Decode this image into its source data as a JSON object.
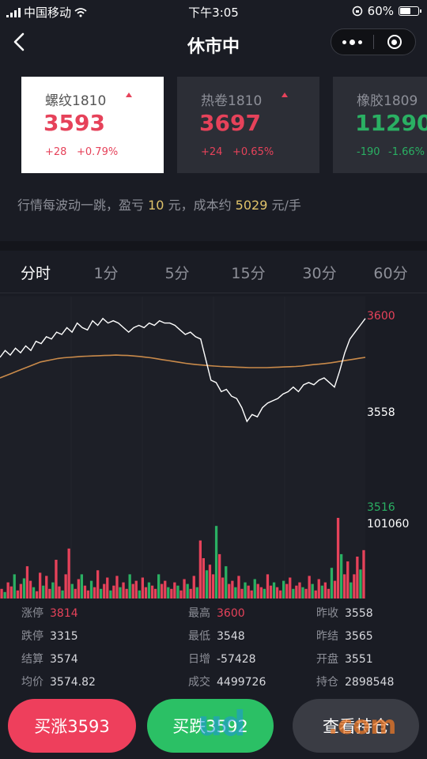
{
  "status": {
    "carrier": "中国移动",
    "time": "下午3:05",
    "battery": "60%",
    "battery_level": 0.6
  },
  "nav": {
    "title": "休市中"
  },
  "cards": [
    {
      "name": "螺纹1810",
      "price": "3593",
      "change": "+28",
      "pct": "+0.79%",
      "direction": "up"
    },
    {
      "name": "热卷1810",
      "price": "3697",
      "change": "+24",
      "pct": "+0.65%",
      "direction": "up"
    },
    {
      "name": "橡胶1809",
      "price": "11290",
      "change": "-190",
      "pct": "-1.66%",
      "direction": "down"
    }
  ],
  "hint": {
    "prefix": "行情每波动一跳，盈亏",
    "tick_value": "10",
    "mid": "元，成本约",
    "cost": "5029",
    "suffix": "元/手"
  },
  "tabs": [
    "分时",
    "1分",
    "5分",
    "15分",
    "30分",
    "60分"
  ],
  "active_tab": 0,
  "chart_data": {
    "type": "line",
    "y_high_label": "3600",
    "y_mid_label": "3558",
    "y_low_label": "3516",
    "volume_label": "101060",
    "ylim": [
      3516,
      3600
    ],
    "price": [
      3581,
      3584,
      3582,
      3585,
      3583,
      3586,
      3584,
      3588,
      3587,
      3590,
      3589,
      3592,
      3591,
      3594,
      3592,
      3596,
      3594,
      3593,
      3597,
      3595,
      3598,
      3596,
      3597,
      3596,
      3594,
      3592,
      3594,
      3595,
      3594,
      3596,
      3595,
      3597,
      3596,
      3596,
      3595,
      3593,
      3591,
      3592,
      3590,
      3589,
      3580,
      3571,
      3570,
      3566,
      3567,
      3564,
      3563,
      3559,
      3553,
      3556,
      3555,
      3559,
      3561,
      3562,
      3563,
      3565,
      3566,
      3568,
      3566,
      3569,
      3570,
      3569,
      3571,
      3572,
      3570,
      3568,
      3575,
      3583,
      3589,
      3592,
      3595,
      3598
    ],
    "avg": [
      3572,
      3573,
      3574,
      3575,
      3576,
      3577,
      3578,
      3579,
      3579.5,
      3580,
      3580.5,
      3580.8,
      3581,
      3581.2,
      3581.4,
      3581.5,
      3581.6,
      3581.7,
      3581.8,
      3581.9,
      3582,
      3581.9,
      3581.8,
      3581.6,
      3581.4,
      3581.1,
      3580.8,
      3580.4,
      3580,
      3579.6,
      3579.2,
      3578.8,
      3578.4,
      3578.1,
      3577.8,
      3577.6,
      3577.4,
      3577.2,
      3577,
      3576.9,
      3576.8,
      3576.7,
      3576.6,
      3576.5,
      3576.5,
      3576.5,
      3576.5,
      3576.6,
      3576.7,
      3576.8,
      3576.9,
      3577,
      3577.2,
      3577.5,
      3577.8,
      3578,
      3578.3,
      3578.6,
      3579,
      3579.4,
      3579.8,
      3580.2,
      3580.6,
      3581
    ],
    "volume": [
      0.12,
      0.08,
      0.2,
      0.15,
      0.3,
      0.1,
      0.18,
      0.25,
      0.4,
      0.22,
      0.14,
      0.09,
      0.32,
      0.16,
      0.28,
      0.12,
      0.2,
      0.48,
      0.15,
      0.1,
      0.3,
      0.62,
      0.18,
      0.12,
      0.24,
      0.3,
      0.16,
      0.1,
      0.22,
      0.14,
      0.35,
      0.12,
      0.18,
      0.26,
      0.1,
      0.16,
      0.28,
      0.14,
      0.2,
      0.12,
      0.3,
      0.18,
      0.22,
      0.1,
      0.26,
      0.14,
      0.2,
      0.16,
      0.12,
      0.3,
      0.18,
      0.22,
      0.14,
      0.12,
      0.2,
      0.16,
      0.1,
      0.24,
      0.18,
      0.12,
      0.28,
      0.14,
      0.72,
      0.5,
      0.35,
      0.42,
      0.3,
      0.9,
      0.55,
      0.26,
      0.4,
      0.18,
      0.22,
      0.14,
      0.28,
      0.12,
      0.2,
      0.16,
      0.1,
      0.24,
      0.18,
      0.14,
      0.12,
      0.3,
      0.16,
      0.2,
      0.14,
      0.1,
      0.22,
      0.18,
      0.26,
      0.12,
      0.16,
      0.2,
      0.14,
      0.12,
      0.28,
      0.18,
      0.1,
      0.24,
      0.16,
      0.2,
      0.12,
      0.38,
      0.22,
      1.0,
      0.55,
      0.3,
      0.46,
      0.2,
      0.3,
      0.52,
      0.36,
      0.6
    ]
  },
  "stats": [
    {
      "label": "涨停",
      "value": "3814",
      "red": true
    },
    {
      "label": "最高",
      "value": "3600",
      "red": true
    },
    {
      "label": "昨收",
      "value": "3558"
    },
    {
      "label": "跌停",
      "value": "3315"
    },
    {
      "label": "最低",
      "value": "3548"
    },
    {
      "label": "昨结",
      "value": "3565"
    },
    {
      "label": "结算",
      "value": "3574"
    },
    {
      "label": "日增",
      "value": "-57428"
    },
    {
      "label": "开盘",
      "value": "3551"
    },
    {
      "label": "均价",
      "value": "3574.82"
    },
    {
      "label": "成交",
      "value": "4499726"
    },
    {
      "label": "持仓",
      "value": "2898548"
    }
  ],
  "buttons": {
    "buy": "买涨3593",
    "sell": "买跌3592",
    "position": "查看持仓"
  },
  "watermark": {
    "text1": "ud",
    "text2": ".com"
  },
  "colors": {
    "up": "#e6425a",
    "down": "#2ab063",
    "avg_line": "#c98a4a",
    "price_line": "#ffffff"
  }
}
